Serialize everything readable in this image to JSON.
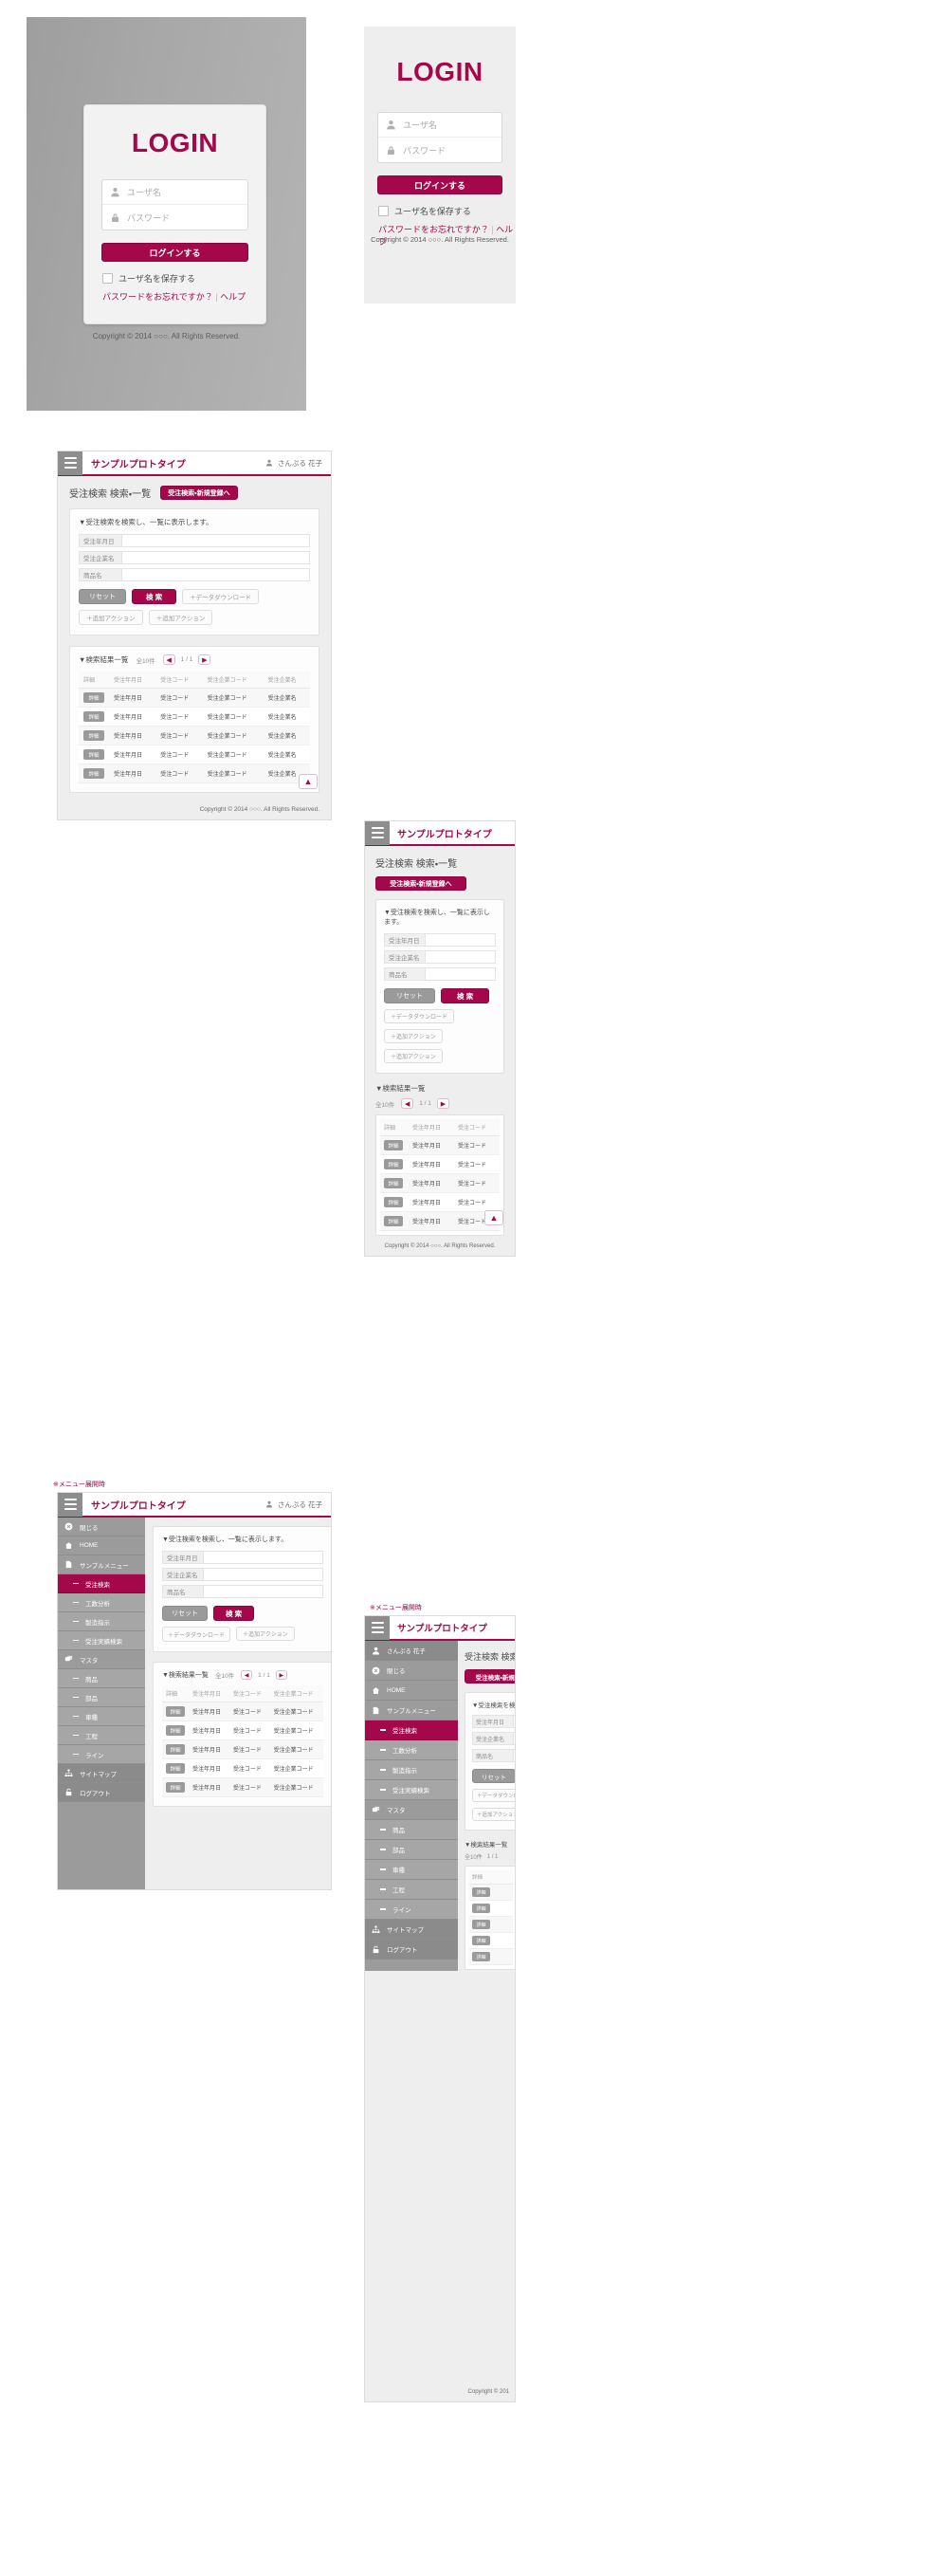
{
  "brand_color": "#a4074a",
  "login": {
    "title": "LOGIN",
    "username_placeholder": "ユーザ名",
    "password_placeholder": "パスワード",
    "submit_label": "ログインする",
    "remember_label": "ユーザ名を保存する",
    "forgot_label": "パスワードをお忘れですか？",
    "separator": "|",
    "help_label": "ヘルプ",
    "copyright": "Copyright © 2014 ○○○. All Rights Reserved."
  },
  "app": {
    "brand": "サンプルプロトタイプ",
    "user_name": "さんぷる 花子",
    "page_title": "受注検索 検索・一覧",
    "new_button": "受注検索・新規登録へ",
    "search_desc": "▼受注検索を検索し、一覧に表示します。",
    "form_fields": [
      {
        "label": "受注年月日",
        "value": ""
      },
      {
        "label": "受注企業名",
        "value": ""
      },
      {
        "label": "商品名",
        "value": ""
      }
    ],
    "buttons": {
      "reset": "リセット",
      "search": "検 索",
      "download": "＋データダウンロード",
      "action1": "＋追加アクション",
      "action2": "＋追加アクション"
    },
    "results": {
      "heading": "▼検索結果一覧",
      "count": "全10件",
      "page": "1 / 1",
      "prev_icon": "chevron-left",
      "next_icon": "chevron-right",
      "columns": [
        "詳細",
        "受注年月日",
        "受注コード",
        "受注企業コード",
        "受注企業名"
      ],
      "detail_label": "詳細",
      "rows": [
        [
          "詳細",
          "受注年月日",
          "受注コード",
          "受注企業コード",
          "受注企業名"
        ],
        [
          "詳細",
          "受注年月日",
          "受注コード",
          "受注企業コード",
          "受注企業名"
        ],
        [
          "詳細",
          "受注年月日",
          "受注コード",
          "受注企業コード",
          "受注企業名"
        ],
        [
          "詳細",
          "受注年月日",
          "受注コード",
          "受注企業コード",
          "受注企業名"
        ],
        [
          "詳細",
          "受注年月日",
          "受注コード",
          "受注企業コード",
          "受注企業名"
        ]
      ]
    },
    "to_top": "▲",
    "footer": "Copyright © 2014 ○○○. All Rights Reserved.",
    "footer_short": "Copyright © 201"
  },
  "menu": {
    "caption": "※メニュー展開時",
    "user": "さんぷる 花子",
    "items": [
      {
        "label": "閉じる",
        "icon": "close-circle-icon",
        "level": "top"
      },
      {
        "label": "HOME",
        "icon": "home-icon",
        "level": "top"
      },
      {
        "label": "サンプルメニュー",
        "icon": "page-icon",
        "level": "top"
      },
      {
        "label": "受注検索",
        "icon": "dash-icon",
        "level": "sub",
        "active": true
      },
      {
        "label": "工数分析",
        "icon": "dash-icon",
        "level": "sub"
      },
      {
        "label": "製造指示",
        "icon": "dash-icon",
        "level": "sub"
      },
      {
        "label": "受注実績検索",
        "icon": "dash-icon",
        "level": "sub"
      },
      {
        "label": "マスタ",
        "icon": "stack-icon",
        "level": "top"
      },
      {
        "label": "商品",
        "icon": "dash-icon",
        "level": "sub"
      },
      {
        "label": "部品",
        "icon": "dash-icon",
        "level": "sub"
      },
      {
        "label": "車種",
        "icon": "dash-icon",
        "level": "sub"
      },
      {
        "label": "工程",
        "icon": "dash-icon",
        "level": "sub"
      },
      {
        "label": "ライン",
        "icon": "dash-icon",
        "level": "sub"
      },
      {
        "label": "サイトマップ",
        "icon": "sitemap-icon",
        "level": "dark"
      },
      {
        "label": "ログアウト",
        "icon": "lock-icon",
        "level": "dark"
      }
    ]
  }
}
